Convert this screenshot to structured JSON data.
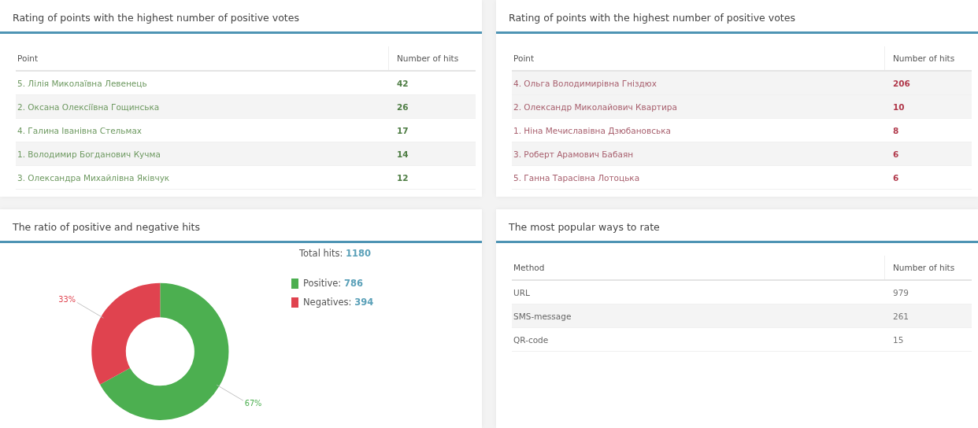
{
  "panels": [
    {
      "title": "Rating of points with the highest number of positive votes",
      "kind": "positive",
      "columns": [
        "Point",
        "Number of hits"
      ],
      "rows": [
        [
          "5. Лілія Миколаївна Левенець",
          "42"
        ],
        [
          "2. Оксана Олексіївна Гощинська",
          "26"
        ],
        [
          "4. Галина Іванівна Стельмах",
          "17"
        ],
        [
          "1. Володимир Богданович Кучма",
          "14"
        ],
        [
          "3. Олександра Михайлівна Яківчук",
          "12"
        ]
      ]
    },
    {
      "title": "Rating of points with the highest number of positive votes",
      "kind": "negative",
      "columns": [
        "Point",
        "Number of hits"
      ],
      "rows": [
        [
          "4. Ольга Володимирівна Гніздюх",
          "206"
        ],
        [
          "2. Олександр Миколайович Квартира",
          "10"
        ],
        [
          "1. Ніна Мечиславівна Дзюбановська",
          "8"
        ],
        [
          "3. Роберт Арамович Бабаян",
          "6"
        ],
        [
          "5. Ганна Тарасівна Лотоцька",
          "6"
        ]
      ]
    }
  ],
  "ratio": {
    "title": "The ratio of positive and negative hits",
    "total_label": "Total hits:",
    "total": "1180",
    "legend": [
      {
        "label": "Positive:",
        "value": "786",
        "color": "#4caf50"
      },
      {
        "label": "Negatives:",
        "value": "394",
        "color": "#e0434f"
      }
    ],
    "chart_data": {
      "type": "donut",
      "values": [
        67,
        33
      ],
      "value_labels": [
        "67%",
        "33%"
      ]
    }
  },
  "methods": {
    "title": "The most popular ways to rate",
    "kind": "neutral",
    "columns": [
      "Method",
      "Number of hits"
    ],
    "rows": [
      [
        "URL",
        "979"
      ],
      [
        "SMS-message",
        "261"
      ],
      [
        "QR-code",
        "15"
      ]
    ]
  }
}
